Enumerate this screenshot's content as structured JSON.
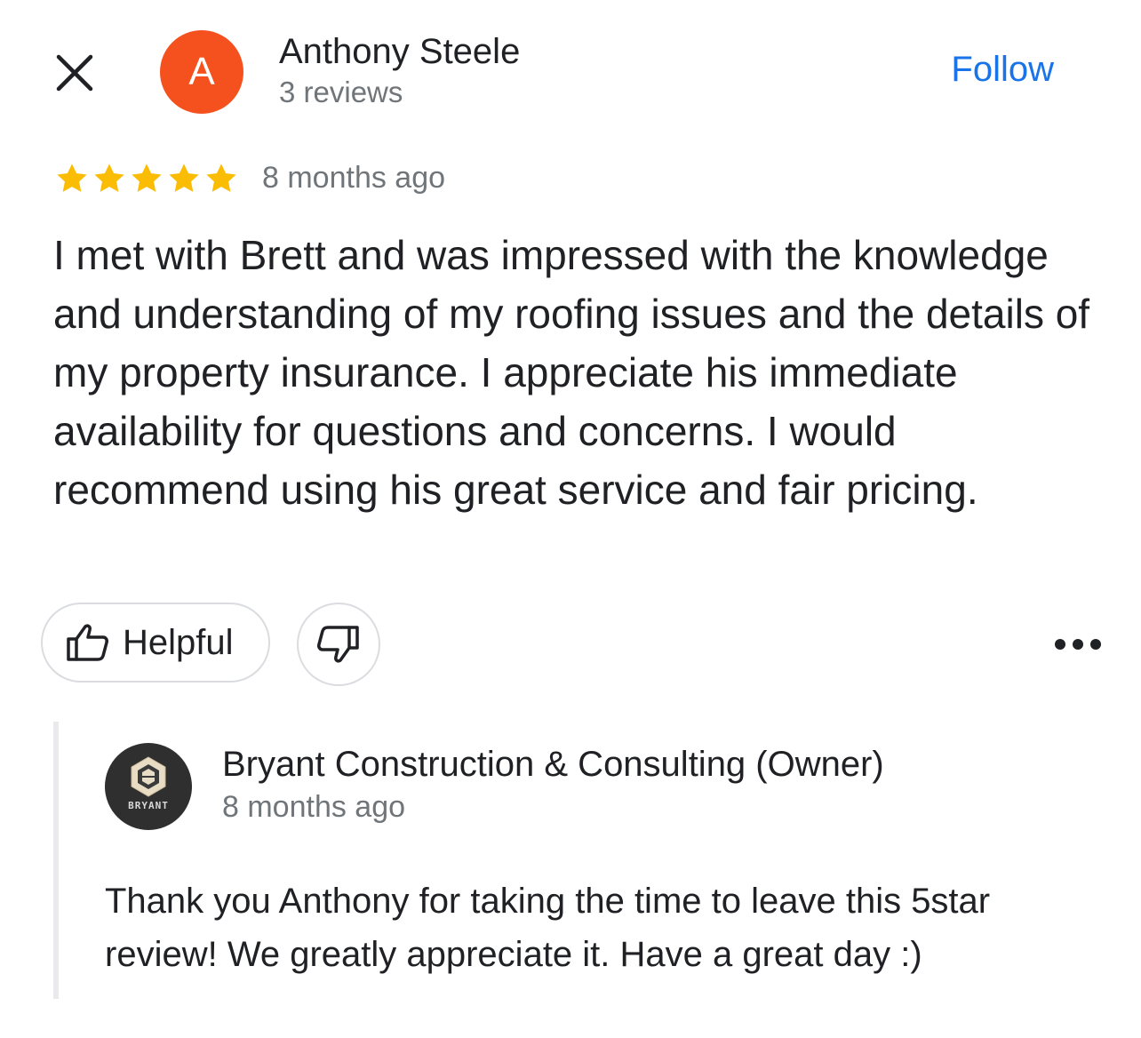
{
  "header": {
    "close_icon": "close-icon",
    "avatar_letter": "A",
    "avatar_color": "#f4511e",
    "reviewer_name": "Anthony Steele",
    "review_count": "3 reviews",
    "follow_label": "Follow",
    "accent_color": "#1a73e8"
  },
  "review": {
    "rating": 5,
    "max_rating": 5,
    "star_color": "#fbbc04",
    "date": "8 months ago",
    "text": "I met with Brett and was impressed with the knowledge and understanding of my roofing issues and the details of my property insurance. I appreciate his immediate availability for questions and concerns. I would recommend using his great service and fair pricing."
  },
  "actions": {
    "helpful_label": "Helpful",
    "helpful_icon": "thumbs-up-icon",
    "unhelpful_icon": "thumbs-down-icon",
    "more_icon": "more-horizontal-icon"
  },
  "owner_reply": {
    "name": "Bryant Construction & Consulting (Owner)",
    "date": "8 months ago",
    "logo_text": "BRYANT",
    "text": "Thank you Anthony for taking the time to leave this 5star review! We greatly appreciate it. Have a great day :)"
  }
}
